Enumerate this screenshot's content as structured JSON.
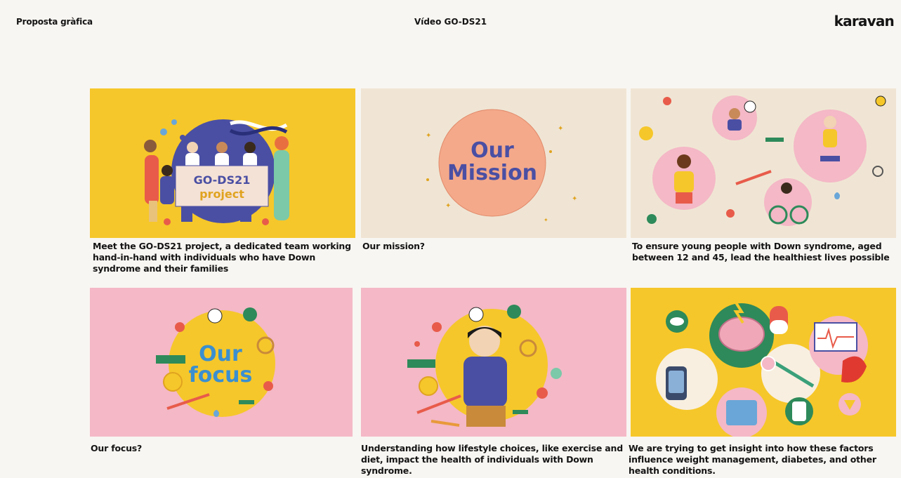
{
  "header": {
    "left_label": "Proposta gràfica",
    "center_title": "Vídeo GO-DS21",
    "logo": "karavan"
  },
  "colors": {
    "yellow": "#f6c72a",
    "beige": "#f0e5d4",
    "pink": "#f4b8c6",
    "navy": "#4a4fa3",
    "salmon": "#f4a98a"
  },
  "cards": [
    {
      "art_text_1": "GO-DS21",
      "art_text_2": "project",
      "caption": "Meet the GO-DS21 project, a dedicated team working hand-in-hand with individuals who have Down syndrome and their families"
    },
    {
      "art_text_1": "Our",
      "art_text_2": "Mission",
      "caption": "Our mission?"
    },
    {
      "caption": "To ensure young people with Down syndrome, aged between 12 and 45, lead the healthiest lives possible"
    },
    {
      "art_text_1": "Our",
      "art_text_2": "focus",
      "caption": "Our focus?"
    },
    {
      "caption": "Understanding how lifestyle choices, like exercise and diet, impact the health of individuals with Down syndrome."
    },
    {
      "caption": "We are trying to get insight into how these factors influence weight management, diabetes, and other health conditions."
    }
  ]
}
